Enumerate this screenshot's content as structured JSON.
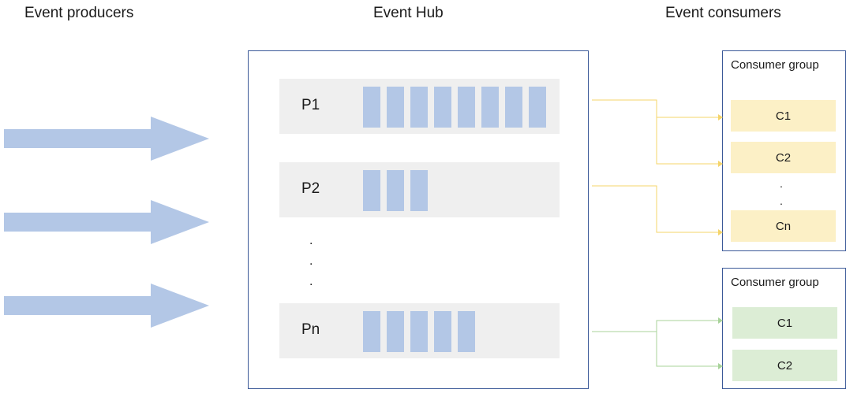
{
  "headings": {
    "producers": "Event producers",
    "hub": "Event Hub",
    "consumers": "Event consumers"
  },
  "hub": {
    "partitions": [
      {
        "label": "P1",
        "event_count": 8
      },
      {
        "label": "P2",
        "event_count": 3
      },
      {
        "label": "Pn",
        "event_count": 5
      }
    ],
    "ellipsis": ".\n.\n."
  },
  "consumer_groups": [
    {
      "title": "Consumer group",
      "consumers": [
        "C1",
        "C2",
        "Cn"
      ],
      "ellipsis": ".\n.",
      "color": "#fcf0c6",
      "line_color": "#f5d46a"
    },
    {
      "title": "Consumer group",
      "consumers": [
        "C1",
        "C2"
      ],
      "color": "#dcedd5",
      "line_color": "#a8d39a"
    }
  ],
  "colors": {
    "producer_arrow": "#b3c7e6",
    "event_block": "#b3c7e6",
    "partition_bg": "#efefef",
    "box_border": "#3b5998"
  }
}
